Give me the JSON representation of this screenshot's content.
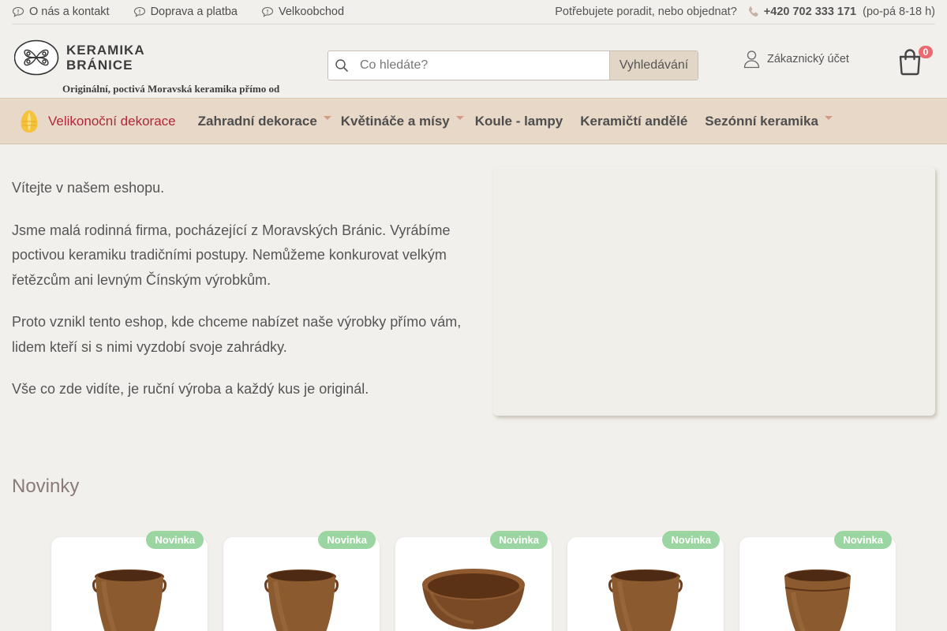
{
  "topbar": {
    "links": [
      "O nás a kontakt",
      "Doprava a platba",
      "Velkoobchod"
    ],
    "contact_question": "Potřebujete poradit, nebo objednat?",
    "phone": "+420 702 333 171",
    "hours": "(po-pá 8-18 h)"
  },
  "header": {
    "logo_line1": "KERAMIKA",
    "logo_line2": "BRÁNICE",
    "tagline": "Originální, poctivá Moravská keramika přímo od výrobce.",
    "search_placeholder": "Co hledáte?",
    "search_button": "Vyhledávání",
    "account_label": "Zákaznický účet",
    "cart_count": "0"
  },
  "nav": {
    "items": [
      "Velikonoční dekorace",
      "Zahradní dekorace",
      "Květináče a mísy",
      "Koule - lampy",
      "Keramičtí andělé",
      "Sezónní keramika"
    ]
  },
  "intro": {
    "paragraphs": [
      "Vítejte v našem eshopu.",
      "Jsme malá rodinná firma, pocházející z Moravských Bránic. Vyrábíme poctivou keramiku tradičními postupy. Nemůžeme konkurovat velkým řetězcům ani levným Čínským výrobkům.",
      "Proto vznikl tento eshop, kde chceme nabízet naše výrobky přímo vám, lidem kteří si s nimi vyzdobí svoje zahrádky.",
      "Vše co zde vidíte, je ruční výroba a každý kus je originál."
    ]
  },
  "section": {
    "title": "Novinky"
  },
  "products": [
    {
      "tag": "Novinka",
      "kind": "pot"
    },
    {
      "tag": "Novinka",
      "kind": "pot"
    },
    {
      "tag": "Novinka",
      "kind": "bowl"
    },
    {
      "tag": "Novinka",
      "kind": "pot"
    },
    {
      "tag": "Novinka",
      "kind": "pot"
    }
  ],
  "colors": {
    "nav_bg": "#e8d8c7",
    "accent_red": "#b12838",
    "badge": "#ea6a70",
    "new_tag": "#9bd6a2"
  }
}
